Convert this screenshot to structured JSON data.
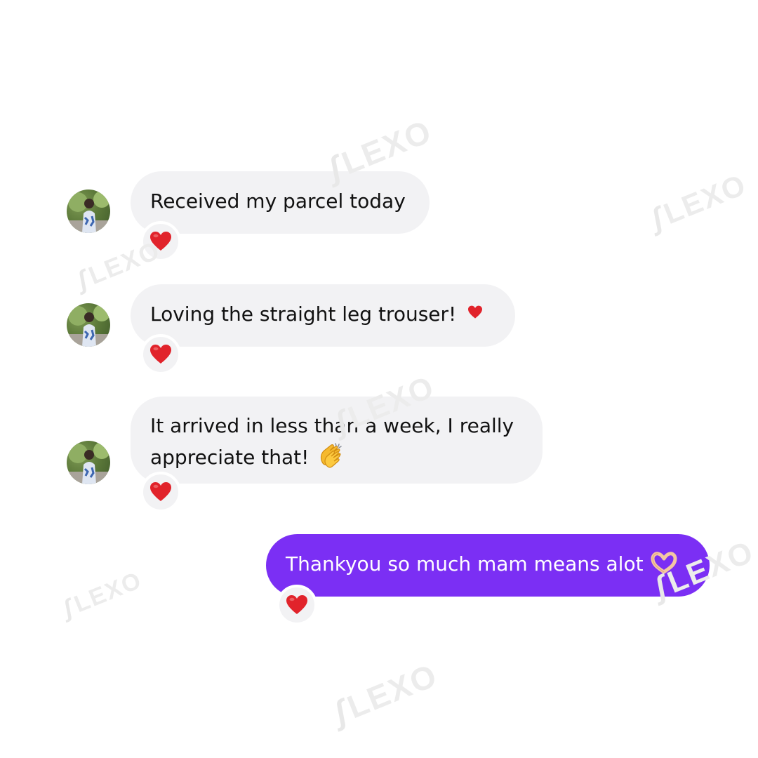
{
  "watermark_text": "LEXO",
  "messages": [
    {
      "direction": "incoming",
      "lines": [
        "Received my parcel today"
      ],
      "reaction_icon": "red-heart-icon"
    },
    {
      "direction": "incoming",
      "lines": [
        "Loving the straight leg trouser!"
      ],
      "inline_icon": "red-heart-icon",
      "reaction_icon": "red-heart-icon"
    },
    {
      "direction": "incoming",
      "lines": [
        "It arrived in less than a week, I really",
        "appreciate that!"
      ],
      "inline_icon": "clapping-hands-icon",
      "reaction_icon": "red-heart-icon"
    },
    {
      "direction": "outgoing",
      "lines": [
        "Thankyou so much mam means alot"
      ],
      "inline_icon": "heart-hands-icon",
      "reaction_icon": "red-heart-icon"
    }
  ],
  "colors": {
    "incoming_bubble": "#f2f2f4",
    "outgoing_bubble": "#7b2ff4",
    "heart": "#e1232b",
    "watermark": "#ececec"
  }
}
